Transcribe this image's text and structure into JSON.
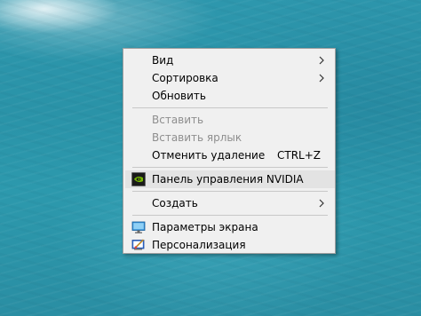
{
  "context_menu": {
    "items": [
      {
        "label": "Вид",
        "submenu": true,
        "enabled": true
      },
      {
        "label": "Сортировка",
        "submenu": true,
        "enabled": true
      },
      {
        "label": "Обновить",
        "enabled": true
      },
      {
        "label": "Вставить",
        "enabled": false
      },
      {
        "label": "Вставить ярлык",
        "enabled": false
      },
      {
        "label": "Отменить удаление",
        "shortcut": "CTRL+Z",
        "enabled": true
      },
      {
        "label": "Панель управления NVIDIA",
        "icon": "nvidia-icon",
        "enabled": true
      },
      {
        "label": "Создать",
        "submenu": true,
        "enabled": true
      },
      {
        "label": "Параметры экрана",
        "icon": "display-settings-icon",
        "enabled": true
      },
      {
        "label": "Персонализация",
        "icon": "personalization-icon",
        "enabled": true
      }
    ]
  },
  "colors": {
    "menu_background": "#f0f0f0",
    "menu_border": "#a0a0a0",
    "disabled_text": "#8e8e8e",
    "desktop_water": "#2a93a8"
  }
}
